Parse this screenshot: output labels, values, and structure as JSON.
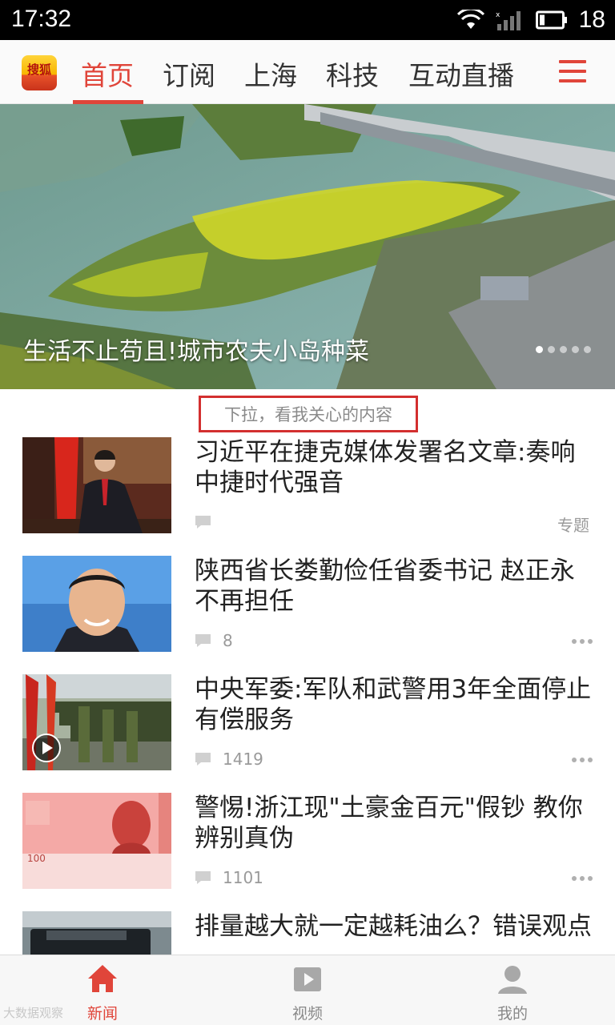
{
  "status_bar": {
    "time": "17:32",
    "battery": "18"
  },
  "channels": {
    "logo_text": "搜狐",
    "tabs": [
      {
        "label": "首页",
        "active": true
      },
      {
        "label": "订阅",
        "active": false
      },
      {
        "label": "上海",
        "active": false
      },
      {
        "label": "科技",
        "active": false
      },
      {
        "label": "互动直播",
        "active": false
      }
    ]
  },
  "banner": {
    "caption": "生活不止苟且!城市农夫小岛种菜",
    "page_dots": 5,
    "current_dot": 1
  },
  "pull_hint": "下拉，看我关心的内容",
  "news": [
    {
      "title": "习近平在捷克媒体发署名文章:奏响中捷时代强音",
      "comments": "",
      "tag": "专题",
      "thumb": "portrait-flag"
    },
    {
      "title": "陕西省长娄勤俭任省委书记 赵正永不再担任",
      "comments": "8",
      "tag": "",
      "thumb": "portrait-blue"
    },
    {
      "title": "中央军委:军队和武警用3年全面停止有偿服务",
      "comments": "1419",
      "tag": "",
      "thumb": "army-video"
    },
    {
      "title": "警惕!浙江现\"土豪金百元\"假钞 教你辨别真伪",
      "comments": "1101",
      "tag": "",
      "thumb": "banknote"
    },
    {
      "title": "排量越大就一定越耗油么？错误观点",
      "comments": "",
      "tag": "",
      "thumb": "car"
    }
  ],
  "bottom_nav": [
    {
      "label": "新闻",
      "icon": "home-icon",
      "active": true
    },
    {
      "label": "视频",
      "icon": "play-icon",
      "active": false
    },
    {
      "label": "我的",
      "icon": "user-icon",
      "active": false
    }
  ],
  "watermark": "大数据观察",
  "colors": {
    "accent": "#e0453a",
    "hint_border": "#d32f2f"
  }
}
